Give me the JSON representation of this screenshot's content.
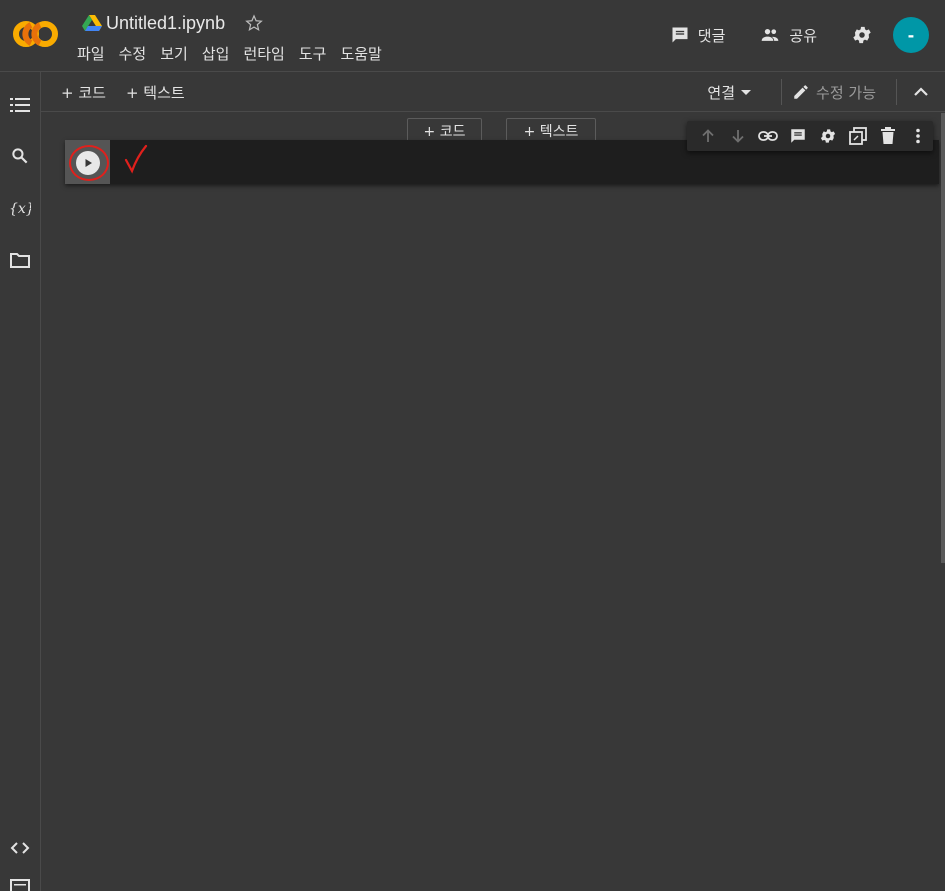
{
  "header": {
    "title": "Untitled1.ipynb",
    "menu": [
      "파일",
      "수정",
      "보기",
      "삽입",
      "런타임",
      "도구",
      "도움말"
    ],
    "comments_label": "댓글",
    "share_label": "공유",
    "avatar_initial": "-",
    "logo_text": "CO"
  },
  "toolbar": {
    "add_code_label": "+ 코드",
    "add_text_label": "+ 텍스트",
    "connect_label": "연결",
    "editable_label": "수정 가능"
  },
  "cell_insert": {
    "code_label": "+ 코드",
    "text_label": "+ 텍스트"
  },
  "colors": {
    "background": "#383838",
    "cell_bg": "#1e1e1e",
    "accent_teal": "#0097a7",
    "logo_orange": "#f9ab00",
    "annotation_red": "#e0201c"
  },
  "icons": {
    "sidebar": [
      "toc-icon",
      "search-icon",
      "variables-icon",
      "folder-icon",
      "code-snippets-icon",
      "terminal-icon"
    ],
    "cell_toolbar": [
      "arrow-up-icon",
      "arrow-down-icon",
      "link-icon",
      "comment-icon",
      "gear-icon",
      "mirror-cell-icon",
      "delete-icon",
      "more-vert-icon"
    ]
  }
}
